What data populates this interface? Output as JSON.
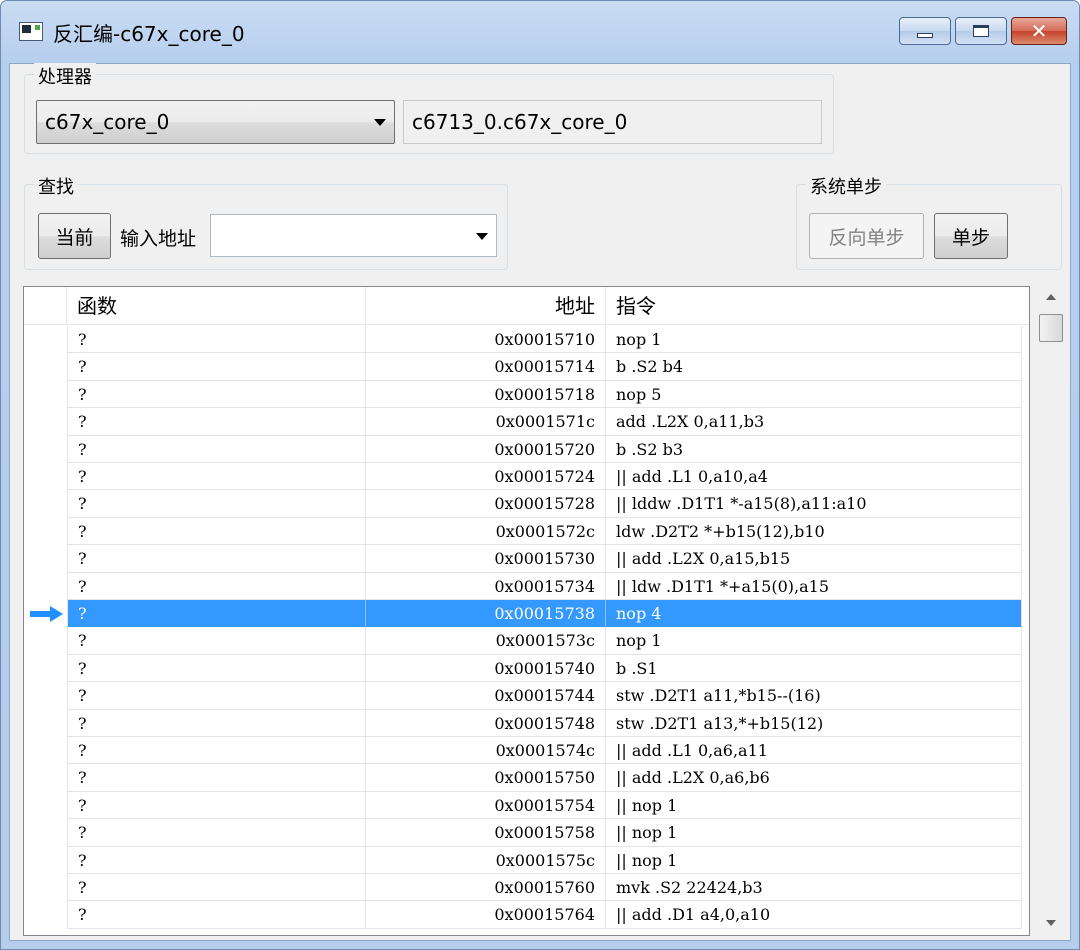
{
  "window": {
    "title": "反汇编-c67x_core_0"
  },
  "processor": {
    "group_label": "处理器",
    "selected": "c67x_core_0",
    "path": "c6713_0.c67x_core_0"
  },
  "search": {
    "group_label": "查找",
    "current_button": "当前",
    "address_label": "输入地址",
    "address_value": ""
  },
  "step": {
    "group_label": "系统单步",
    "reverse_button": "反向单步",
    "step_button": "单步"
  },
  "table": {
    "columns": [
      "函数",
      "地址",
      "指令"
    ],
    "current_row": 10,
    "rows": [
      {
        "fn": "?",
        "addr": "0x00015710",
        "ins": "nop 1"
      },
      {
        "fn": "?",
        "addr": "0x00015714",
        "ins": "b .S2 b4"
      },
      {
        "fn": "?",
        "addr": "0x00015718",
        "ins": "nop 5"
      },
      {
        "fn": "?",
        "addr": "0x0001571c",
        "ins": "add .L2X 0,a11,b3"
      },
      {
        "fn": "?",
        "addr": "0x00015720",
        "ins": "b .S2 b3"
      },
      {
        "fn": "?",
        "addr": "0x00015724",
        "ins": "|| add .L1 0,a10,a4"
      },
      {
        "fn": "?",
        "addr": "0x00015728",
        "ins": "|| lddw .D1T1 *-a15(8),a11:a10"
      },
      {
        "fn": "?",
        "addr": "0x0001572c",
        "ins": "ldw .D2T2 *+b15(12),b10"
      },
      {
        "fn": "?",
        "addr": "0x00015730",
        "ins": "|| add .L2X 0,a15,b15"
      },
      {
        "fn": "?",
        "addr": "0x00015734",
        "ins": "|| ldw .D1T1 *+a15(0),a15"
      },
      {
        "fn": "?",
        "addr": "0x00015738",
        "ins": "nop 4"
      },
      {
        "fn": "?",
        "addr": "0x0001573c",
        "ins": "nop 1"
      },
      {
        "fn": "?",
        "addr": "0x00015740",
        "ins": "b .S1"
      },
      {
        "fn": "?",
        "addr": "0x00015744",
        "ins": "stw .D2T1 a11,*b15--(16)"
      },
      {
        "fn": "?",
        "addr": "0x00015748",
        "ins": "stw .D2T1 a13,*+b15(12)"
      },
      {
        "fn": "?",
        "addr": "0x0001574c",
        "ins": "|| add .L1 0,a6,a11"
      },
      {
        "fn": "?",
        "addr": "0x00015750",
        "ins": "|| add .L2X 0,a6,b6"
      },
      {
        "fn": "?",
        "addr": "0x00015754",
        "ins": "|| nop 1"
      },
      {
        "fn": "?",
        "addr": "0x00015758",
        "ins": "|| nop 1"
      },
      {
        "fn": "?",
        "addr": "0x0001575c",
        "ins": "|| nop 1"
      },
      {
        "fn": "?",
        "addr": "0x00015760",
        "ins": "mvk .S2 22424,b3"
      },
      {
        "fn": "?",
        "addr": "0x00015764",
        "ins": "|| add .D1 a4,0,a10"
      }
    ]
  },
  "icons": {
    "current_marker": "arrow-right-icon",
    "selection_color": "#3399ff",
    "marker_color": "#1e90ff"
  }
}
